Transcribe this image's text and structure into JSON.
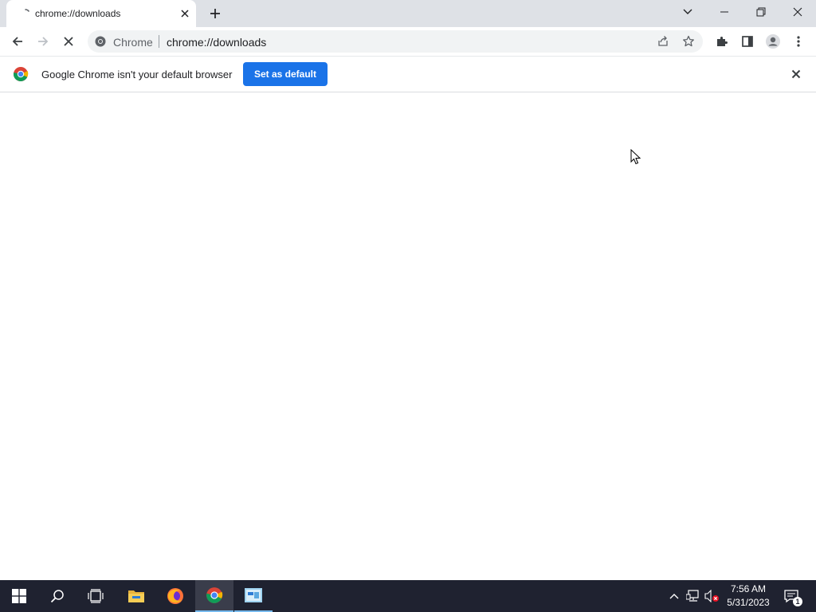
{
  "tab": {
    "title": "chrome://downloads"
  },
  "omnibox": {
    "site_chip": "Chrome",
    "url": "chrome://downloads"
  },
  "infobar": {
    "message": "Google Chrome isn't your default browser",
    "button_label": "Set as default"
  },
  "taskbar": {
    "time": "7:56 AM",
    "date": "5/31/2023",
    "notification_count": "1"
  },
  "colors": {
    "accent": "#1a73e8",
    "tab_strip": "#dee1e6",
    "taskbar": "#1f2230"
  },
  "icons": {
    "tab": [
      "loading-favicon-icon",
      "close-icon",
      "plus-icon"
    ],
    "window": [
      "chevron-down-icon",
      "minimize-icon",
      "restore-icon",
      "close-icon"
    ],
    "toolbar": [
      "back-arrow-icon",
      "forward-arrow-icon",
      "stop-loading-icon",
      "share-icon",
      "star-icon",
      "extensions-puzzle-icon",
      "side-panel-icon",
      "profile-icon",
      "kebab-menu-icon"
    ],
    "taskbar": [
      "windows-start-icon",
      "search-icon",
      "task-view-icon",
      "file-explorer-icon",
      "firefox-icon",
      "chrome-icon",
      "app-icon"
    ],
    "tray": [
      "chevron-up-icon",
      "network-icon",
      "volume-muted-icon",
      "notification-icon"
    ]
  }
}
